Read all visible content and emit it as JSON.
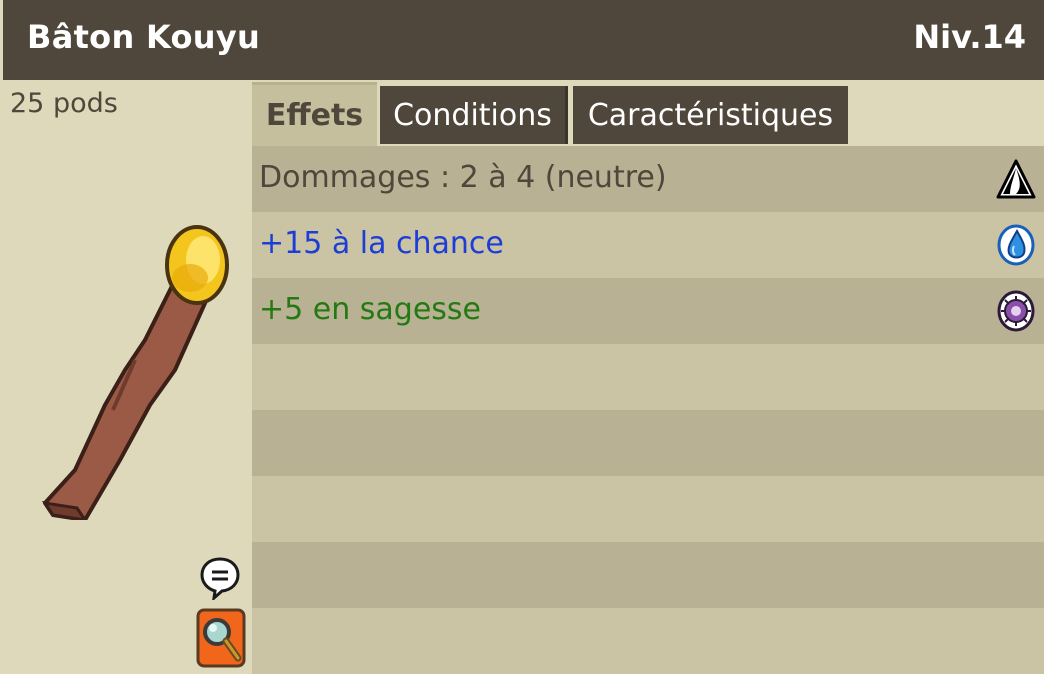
{
  "item": {
    "name": "Bâton Kouyu",
    "level": "Niv.14",
    "weight": "25 pods"
  },
  "tabs": [
    {
      "label": "Effets",
      "active": true
    },
    {
      "label": "Conditions",
      "active": false
    },
    {
      "label": "Caractéristiques",
      "active": false
    }
  ],
  "effects": [
    {
      "text": "Dommages : 2 à 4 (neutre)",
      "color": "#4f473b",
      "icon": "neutral-element-icon"
    },
    {
      "text": "+15 à la chance",
      "color": "#1c3ed6",
      "icon": "water-chance-icon"
    },
    {
      "text": "+5 en sagesse",
      "color": "#237a12",
      "icon": "wisdom-icon"
    }
  ],
  "icons": {
    "chat": "speech-bubble-icon",
    "inspect": "magnifier-icon",
    "item": "staff-item-icon"
  },
  "colors": {
    "header_bg": "#4f473b",
    "panel_bg": "#ded9bb",
    "row_dark": "#b9b194",
    "row_light": "#cbc4a4"
  }
}
